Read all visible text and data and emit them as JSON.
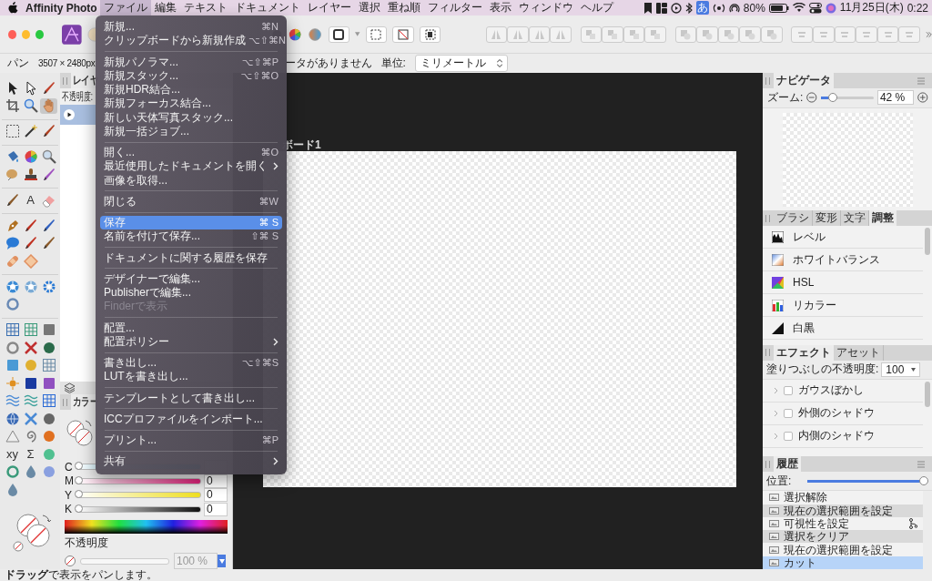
{
  "menubar": {
    "app_name": "Affinity Photo",
    "menus": [
      {
        "label": "ファイル",
        "selected": true
      },
      {
        "label": "編集",
        "selected": false
      },
      {
        "label": "テキスト",
        "selected": false
      },
      {
        "label": "ドキュメント",
        "selected": false
      },
      {
        "label": "レイヤー",
        "selected": false
      },
      {
        "label": "選択",
        "selected": false
      },
      {
        "label": "重ね順",
        "selected": false
      },
      {
        "label": "フィルター",
        "selected": false
      },
      {
        "label": "表示",
        "selected": false
      },
      {
        "label": "ウィンドウ",
        "selected": false
      },
      {
        "label": "ヘルプ",
        "selected": false
      }
    ],
    "input_method": "あ",
    "battery": "80%",
    "date": "11月25日(木)",
    "time": "0:22"
  },
  "context_bar": {
    "tool": "パン",
    "dimensions": "3507 × 2480px",
    "metadata": "ータがありません",
    "unit_label": "単位:",
    "unit": "ミリメートル"
  },
  "tools": [
    [
      {
        "selected": false
      },
      {
        "selected": false
      },
      {
        "selected": false
      },
      {
        "selected": false
      },
      {
        "selected": false
      },
      {
        "selected": true
      }
    ],
    [
      {
        "selected": false
      },
      {
        "selected": false
      },
      {
        "selected": false
      }
    ],
    [
      {
        "selected": false
      },
      {
        "selected": false
      },
      {
        "selected": false
      },
      {
        "selected": false
      },
      {
        "selected": false
      },
      {
        "selected": false
      }
    ],
    [
      {
        "selected": false
      },
      {
        "selected": false,
        "glyph": "A"
      },
      {
        "selected": false
      }
    ],
    [
      {
        "selected": false
      },
      {
        "selected": false
      },
      {
        "selected": false
      },
      {
        "selected": false
      },
      {
        "selected": false
      },
      {
        "selected": false
      },
      {
        "selected": false
      },
      {
        "selected": false
      }
    ],
    [
      {
        "selected": false
      },
      {
        "selected": false
      },
      {
        "selected": false
      },
      {
        "selected": false
      }
    ],
    [
      {
        "selected": false
      },
      {
        "selected": false
      },
      {
        "selected": false
      },
      {
        "selected": false
      },
      {
        "selected": false
      },
      {
        "selected": false
      },
      {
        "selected": false
      },
      {
        "selected": false
      },
      {
        "selected": false
      },
      {
        "selected": false
      },
      {
        "selected": false
      },
      {
        "selected": false
      },
      {
        "selected": false
      },
      {
        "selected": false
      },
      {
        "selected": false
      },
      {
        "selected": false
      },
      {
        "selected": false
      },
      {
        "selected": false
      },
      {
        "selected": false
      },
      {
        "selected": false
      },
      {
        "selected": false
      },
      {
        "selected": false,
        "glyph": "xy"
      },
      {
        "selected": false,
        "glyph": "Σ"
      },
      {
        "selected": false
      },
      {
        "selected": false
      },
      {
        "selected": false
      },
      {
        "selected": false
      },
      {
        "selected": false
      }
    ]
  ],
  "layers_panel": {
    "tab": "レイヤ",
    "opacity_label": "不透明度:",
    "layers": [
      {
        "selected": true
      }
    ]
  },
  "color_panel": {
    "tab": "カラー",
    "channels": [
      {
        "name": "C",
        "level": 0
      },
      {
        "name": "M",
        "level": 0,
        "value": "0"
      },
      {
        "name": "Y",
        "level": 0,
        "value": "0"
      },
      {
        "name": "K",
        "level": 0,
        "value": "0"
      }
    ],
    "opacity_label": "不透明度",
    "opacity_slider": {
      "level": 0
    },
    "opacity": "100 %"
  },
  "canvas": {
    "artboard_label": "ボード1"
  },
  "navigator": {
    "tab": "ナビゲータ",
    "zoom_label": "ズーム:",
    "level": 0.17,
    "zoom": "42 %"
  },
  "adjustments": {
    "tabs": [
      {
        "label": "ブラシ",
        "selected": false
      },
      {
        "label": "変形",
        "selected": false
      },
      {
        "label": "文字",
        "selected": false
      },
      {
        "label": "調整",
        "selected": true
      }
    ],
    "items": [
      {
        "label": "レベル"
      },
      {
        "label": "ホワイトバランス"
      },
      {
        "label": "HSL"
      },
      {
        "label": "リカラー"
      },
      {
        "label": "白黒"
      }
    ]
  },
  "effects": {
    "tabs": [
      {
        "label": "エフェクト",
        "selected": true
      },
      {
        "label": "アセット",
        "selected": false
      }
    ],
    "fill_opacity_label": "塗りつぶしの不透明度:",
    "fill_opacity": "100",
    "items": [
      {
        "label": "ガウスぼかし",
        "checked": false
      },
      {
        "label": "外側のシャドウ",
        "checked": false
      },
      {
        "label": "内側のシャドウ",
        "checked": false
      }
    ]
  },
  "history": {
    "tab": "履歴",
    "position_label": "位置:",
    "level": 1,
    "entries": [
      {
        "label": "選択解除",
        "selected": false,
        "branch": false
      },
      {
        "label": "現在の選択範囲を設定",
        "selected": false,
        "branch": false
      },
      {
        "label": "可視性を設定",
        "selected": false,
        "branch": true
      },
      {
        "label": "選択をクリア",
        "selected": false,
        "branch": false
      },
      {
        "label": "現在の選択範囲を設定",
        "selected": false,
        "branch": false
      },
      {
        "label": "カット",
        "selected": true,
        "branch": false
      }
    ]
  },
  "file_menu": [
    {
      "kind": "item",
      "label": "新規...",
      "shortcut": "⌘N",
      "selected": false,
      "disabled": false,
      "submenu": false
    },
    {
      "kind": "item",
      "label": "クリップボードから新規作成",
      "shortcut": "⌥⇧⌘N",
      "selected": false,
      "disabled": false,
      "submenu": false
    },
    {
      "kind": "separator"
    },
    {
      "kind": "item",
      "label": "新規パノラマ...",
      "shortcut": "⌥⇧⌘P",
      "selected": false,
      "disabled": false,
      "submenu": false
    },
    {
      "kind": "item",
      "label": "新規スタック...",
      "shortcut": "⌥⇧⌘O",
      "selected": false,
      "disabled": false,
      "submenu": false
    },
    {
      "kind": "item",
      "label": "新規HDR結合...",
      "selected": false,
      "disabled": false,
      "submenu": false
    },
    {
      "kind": "item",
      "label": "新規フォーカス結合...",
      "selected": false,
      "disabled": false,
      "submenu": false
    },
    {
      "kind": "item",
      "label": "新しい天体写真スタック...",
      "selected": false,
      "disabled": false,
      "submenu": false
    },
    {
      "kind": "item",
      "label": "新規一括ジョブ...",
      "selected": false,
      "disabled": false,
      "submenu": false
    },
    {
      "kind": "separator"
    },
    {
      "kind": "item",
      "label": "開く...",
      "shortcut": "⌘O",
      "selected": false,
      "disabled": false,
      "submenu": false
    },
    {
      "kind": "item",
      "label": "最近使用したドキュメントを開く",
      "selected": false,
      "disabled": false,
      "submenu": true
    },
    {
      "kind": "item",
      "label": "画像を取得...",
      "selected": false,
      "disabled": false,
      "submenu": false
    },
    {
      "kind": "separator"
    },
    {
      "kind": "item",
      "label": "閉じる",
      "shortcut": "⌘W",
      "selected": false,
      "disabled": false,
      "submenu": false
    },
    {
      "kind": "separator"
    },
    {
      "kind": "item",
      "label": "保存",
      "shortcut": "⌘ S",
      "selected": true,
      "disabled": false,
      "submenu": false
    },
    {
      "kind": "item",
      "label": "名前を付けて保存...",
      "shortcut": "⇧⌘ S",
      "selected": false,
      "disabled": false,
      "submenu": false
    },
    {
      "kind": "separator"
    },
    {
      "kind": "item",
      "label": "ドキュメントに関する履歴を保存",
      "selected": false,
      "disabled": false,
      "submenu": false
    },
    {
      "kind": "separator"
    },
    {
      "kind": "item",
      "label": "デザイナーで編集...",
      "selected": false,
      "disabled": false,
      "submenu": false
    },
    {
      "kind": "item",
      "label": "Publisherで編集...",
      "selected": false,
      "disabled": false,
      "submenu": false
    },
    {
      "kind": "item",
      "label": "Finderで表示",
      "selected": false,
      "disabled": true,
      "submenu": false
    },
    {
      "kind": "separator"
    },
    {
      "kind": "item",
      "label": "配置...",
      "selected": false,
      "disabled": false,
      "submenu": false
    },
    {
      "kind": "item",
      "label": "配置ポリシー",
      "selected": false,
      "disabled": false,
      "submenu": true
    },
    {
      "kind": "separator"
    },
    {
      "kind": "item",
      "label": "書き出し...",
      "shortcut": "⌥⇧⌘S",
      "selected": false,
      "disabled": false,
      "submenu": false
    },
    {
      "kind": "item",
      "label": "LUTを書き出し...",
      "selected": false,
      "disabled": false,
      "submenu": false
    },
    {
      "kind": "separator"
    },
    {
      "kind": "item",
      "label": "テンプレートとして書き出し...",
      "selected": false,
      "disabled": false,
      "submenu": false
    },
    {
      "kind": "separator"
    },
    {
      "kind": "item",
      "label": "ICCプロファイルをインポート...",
      "selected": false,
      "disabled": false,
      "submenu": false
    },
    {
      "kind": "separator"
    },
    {
      "kind": "item",
      "label": "プリント...",
      "shortcut": "⌘P",
      "selected": false,
      "disabled": false,
      "submenu": false
    },
    {
      "kind": "separator"
    },
    {
      "kind": "item",
      "label": "共有",
      "selected": false,
      "disabled": false,
      "submenu": true
    }
  ],
  "status_bar": "**ドラッグ**で表示をパンします。"
}
